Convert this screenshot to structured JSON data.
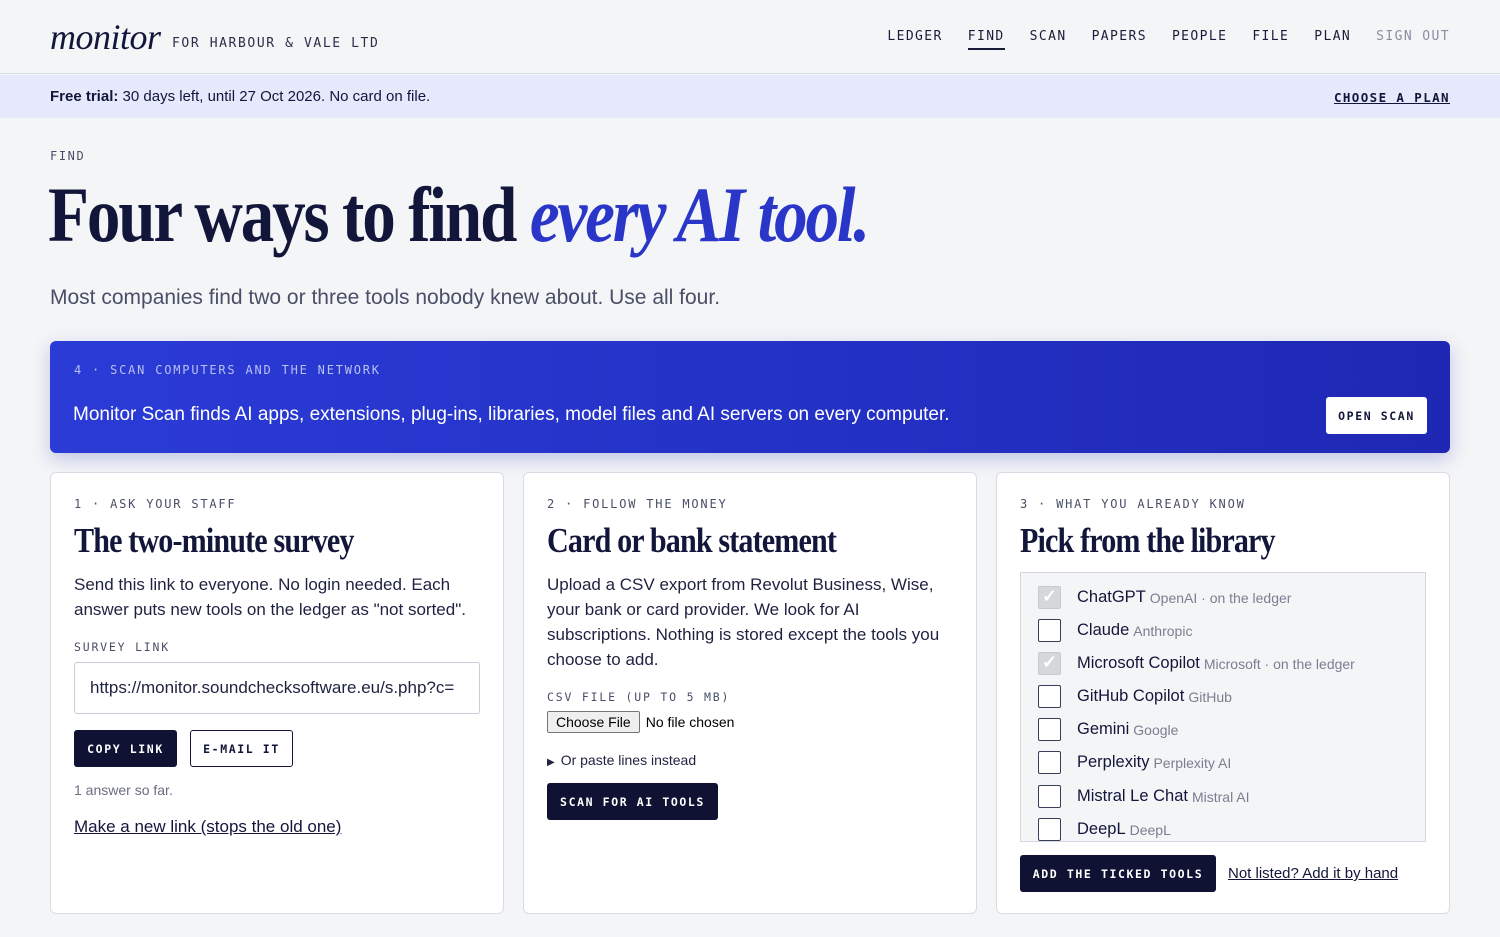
{
  "header": {
    "logo": "monitor",
    "org": "FOR HARBOUR & VALE LTD",
    "nav": [
      "LEDGER",
      "FIND",
      "SCAN",
      "PAPERS",
      "PEOPLE",
      "FILE",
      "PLAN",
      "SIGN OUT"
    ],
    "active_nav": "FIND"
  },
  "banner": {
    "label": "Free trial:",
    "text": " 30 days left, until 27 Oct 2026. No card on file.",
    "link": "CHOOSE A PLAN"
  },
  "hero": {
    "eyebrow": "FIND",
    "title_plain": "Four ways to find ",
    "title_accent": "every AI tool.",
    "subtitle": "Most companies find two or three tools nobody knew about. Use all four."
  },
  "scan": {
    "eyebrow": "4 · SCAN COMPUTERS AND THE NETWORK",
    "text": "Monitor Scan finds AI apps, extensions, plug-ins, libraries, model files and AI servers on every computer.",
    "button": "OPEN SCAN"
  },
  "survey": {
    "eyebrow": "1 · ASK YOUR STAFF",
    "title": "The two-minute survey",
    "body": "Send this link to everyone. No login needed. Each answer puts new tools on the ledger as \"not sorted\".",
    "field_label": "SURVEY LINK",
    "url": "https://monitor.soundchecksoftware.eu/s.php?c=",
    "copy_button": "COPY LINK",
    "email_button": "E-MAIL IT",
    "answers": "1 answer so far.",
    "new_link": "Make a new link (stops the old one)"
  },
  "statement": {
    "eyebrow": "2 · FOLLOW THE MONEY",
    "title": "Card or bank statement",
    "body": "Upload a CSV export from Revolut Business, Wise, your bank or card provider. We look for AI subscriptions. Nothing is stored except the tools you choose to add.",
    "field_label": "CSV FILE (UP TO 5 MB)",
    "file_button": "Choose File",
    "file_status": "No file chosen",
    "paste_toggle": "Or paste lines instead",
    "scan_button": "SCAN FOR AI TOOLS"
  },
  "library": {
    "eyebrow": "3 · WHAT YOU ALREADY KNOW",
    "title": "Pick from the library",
    "items": [
      {
        "name": "ChatGPT",
        "sub": "OpenAI · on the ledger",
        "checked": true
      },
      {
        "name": "Claude",
        "sub": "Anthropic",
        "checked": false
      },
      {
        "name": "Microsoft Copilot",
        "sub": "Microsoft · on the ledger",
        "checked": true
      },
      {
        "name": "GitHub Copilot",
        "sub": "GitHub",
        "checked": false
      },
      {
        "name": "Gemini",
        "sub": "Google",
        "checked": false
      },
      {
        "name": "Perplexity",
        "sub": "Perplexity AI",
        "checked": false
      },
      {
        "name": "Mistral Le Chat",
        "sub": "Mistral AI",
        "checked": false
      },
      {
        "name": "DeepL",
        "sub": "DeepL",
        "checked": false
      }
    ],
    "add_button": "ADD THE TICKED TOOLS",
    "hand_link": "Not listed? Add it by hand"
  }
}
